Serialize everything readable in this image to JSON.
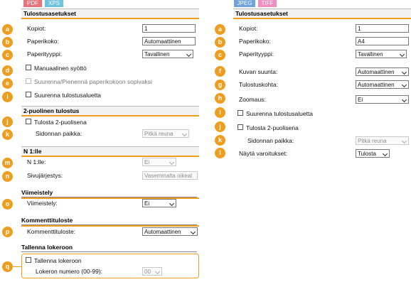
{
  "colors": {
    "accent": "#ef9d1e",
    "pdf_tag": "#e8727a",
    "xps_tag": "#6fc2e0",
    "jpeg_tag": "#6ea4db",
    "tiff_tag": "#f08ec0"
  },
  "left": {
    "tags": {
      "pdf": "PDF",
      "xps": "XPS"
    },
    "section_print": "Tulostusasetukset",
    "copies": {
      "label": "Kopiot:",
      "value": "1"
    },
    "paper_size": {
      "label": "Paperikoko:",
      "value": "Automaattinen"
    },
    "paper_type": {
      "label": "Paperityyppi:",
      "value": "Tavallinen"
    },
    "manual_feed": {
      "label": "Manuaalinen syöttö"
    },
    "enlarge_reduce": {
      "label": "Suurenna/Pienennä paperikokoon sopivaksi"
    },
    "enlarge_area": {
      "label": "Suurenna tulostusaluetta"
    },
    "section_duplex": "2-puolinen tulostus",
    "duplex": {
      "label": "Tulosta 2-puolisena"
    },
    "binding": {
      "label": "Sidonnan paikka:",
      "value": "Pitkä reuna"
    },
    "section_nup": "N 1:lle",
    "nup": {
      "label": "N 1:lle:",
      "value": "Ei"
    },
    "page_order": {
      "label": "Sivujärjestys:",
      "value": "Vasemmalta oikeal"
    },
    "section_finish": "Viimeistely",
    "finishing": {
      "label": "Viimeistely:",
      "value": "Ei"
    },
    "section_comment": "Kommenttituloste",
    "comment": {
      "label": "Kommenttituloste:",
      "value": "Automaattinen"
    },
    "section_store": "Tallenna lokeroon",
    "store": {
      "label": "Tallenna lokeroon"
    },
    "box_no": {
      "label": "Lokeron numero (00-99):",
      "value": "00"
    }
  },
  "right": {
    "tags": {
      "jpeg": "JPEG",
      "tiff": "TIFF"
    },
    "section_print": "Tulostusasetukset",
    "copies": {
      "label": "Kopiot:",
      "value": "1"
    },
    "paper_size": {
      "label": "Paperikoko:",
      "value": "A4"
    },
    "paper_type": {
      "label": "Paperityyppi:",
      "value": "Tavallinen"
    },
    "orientation": {
      "label": "Kuvan suunta:",
      "value": "Automaattinen"
    },
    "print_pos": {
      "label": "Tulostuskohta:",
      "value": "Automaattinen"
    },
    "zoom": {
      "label": "Zoomaus:",
      "value": "Ei"
    },
    "enlarge_area": {
      "label": "Suurenna tulostusaluetta"
    },
    "duplex": {
      "label": "Tulosta 2-puolisena"
    },
    "binding": {
      "label": "Sidonnan paikka:",
      "value": "Pitkä reuna"
    },
    "warnings": {
      "label": "Näytä varoitukset:",
      "value": "Tulosta"
    }
  },
  "badges": {
    "a": "a",
    "b": "b",
    "c": "c",
    "d": "d",
    "e": "e",
    "f": "f",
    "g": "g",
    "h": "h",
    "i": "i",
    "j": "j",
    "k": "k",
    "l": "l",
    "m": "m",
    "n": "n",
    "o": "o",
    "p": "p",
    "q": "q"
  }
}
